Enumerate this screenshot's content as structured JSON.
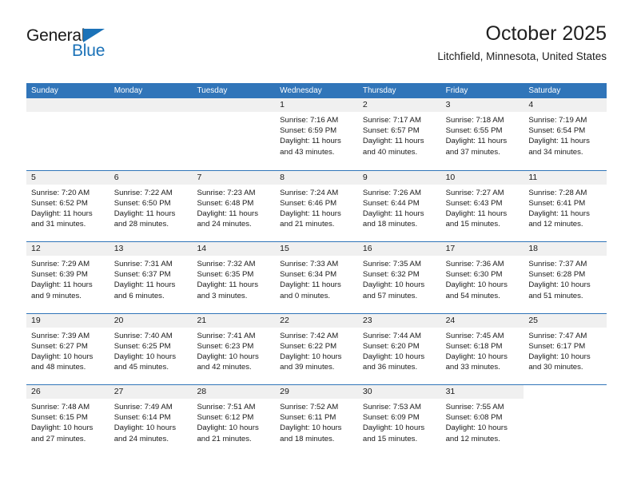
{
  "brand": {
    "word_general": "General",
    "word_blue": "Blue",
    "triangle_color": "#1b72b8"
  },
  "header": {
    "title": "October 2025",
    "subtitle": "Litchfield, Minnesota, United States"
  },
  "theme": {
    "header_blue": "#3175b9",
    "daynum_strip": "#f0f0f0",
    "text": "#1a1a1a",
    "page_background": "#ffffff"
  },
  "weekdays": [
    "Sunday",
    "Monday",
    "Tuesday",
    "Wednesday",
    "Thursday",
    "Friday",
    "Saturday"
  ],
  "labels": {
    "sunrise_prefix": "Sunrise:",
    "sunset_prefix": "Sunset:",
    "daylight_prefix": "Daylight:"
  },
  "weeks": [
    [
      {
        "day": "",
        "empty": true
      },
      {
        "day": "",
        "empty": true
      },
      {
        "day": "",
        "empty": true
      },
      {
        "day": "1",
        "sunrise": "Sunrise: 7:16 AM",
        "sunset": "Sunset: 6:59 PM",
        "daylight": "Daylight: 11 hours and 43 minutes."
      },
      {
        "day": "2",
        "sunrise": "Sunrise: 7:17 AM",
        "sunset": "Sunset: 6:57 PM",
        "daylight": "Daylight: 11 hours and 40 minutes."
      },
      {
        "day": "3",
        "sunrise": "Sunrise: 7:18 AM",
        "sunset": "Sunset: 6:55 PM",
        "daylight": "Daylight: 11 hours and 37 minutes."
      },
      {
        "day": "4",
        "sunrise": "Sunrise: 7:19 AM",
        "sunset": "Sunset: 6:54 PM",
        "daylight": "Daylight: 11 hours and 34 minutes."
      }
    ],
    [
      {
        "day": "5",
        "sunrise": "Sunrise: 7:20 AM",
        "sunset": "Sunset: 6:52 PM",
        "daylight": "Daylight: 11 hours and 31 minutes."
      },
      {
        "day": "6",
        "sunrise": "Sunrise: 7:22 AM",
        "sunset": "Sunset: 6:50 PM",
        "daylight": "Daylight: 11 hours and 28 minutes."
      },
      {
        "day": "7",
        "sunrise": "Sunrise: 7:23 AM",
        "sunset": "Sunset: 6:48 PM",
        "daylight": "Daylight: 11 hours and 24 minutes."
      },
      {
        "day": "8",
        "sunrise": "Sunrise: 7:24 AM",
        "sunset": "Sunset: 6:46 PM",
        "daylight": "Daylight: 11 hours and 21 minutes."
      },
      {
        "day": "9",
        "sunrise": "Sunrise: 7:26 AM",
        "sunset": "Sunset: 6:44 PM",
        "daylight": "Daylight: 11 hours and 18 minutes."
      },
      {
        "day": "10",
        "sunrise": "Sunrise: 7:27 AM",
        "sunset": "Sunset: 6:43 PM",
        "daylight": "Daylight: 11 hours and 15 minutes."
      },
      {
        "day": "11",
        "sunrise": "Sunrise: 7:28 AM",
        "sunset": "Sunset: 6:41 PM",
        "daylight": "Daylight: 11 hours and 12 minutes."
      }
    ],
    [
      {
        "day": "12",
        "sunrise": "Sunrise: 7:29 AM",
        "sunset": "Sunset: 6:39 PM",
        "daylight": "Daylight: 11 hours and 9 minutes."
      },
      {
        "day": "13",
        "sunrise": "Sunrise: 7:31 AM",
        "sunset": "Sunset: 6:37 PM",
        "daylight": "Daylight: 11 hours and 6 minutes."
      },
      {
        "day": "14",
        "sunrise": "Sunrise: 7:32 AM",
        "sunset": "Sunset: 6:35 PM",
        "daylight": "Daylight: 11 hours and 3 minutes."
      },
      {
        "day": "15",
        "sunrise": "Sunrise: 7:33 AM",
        "sunset": "Sunset: 6:34 PM",
        "daylight": "Daylight: 11 hours and 0 minutes."
      },
      {
        "day": "16",
        "sunrise": "Sunrise: 7:35 AM",
        "sunset": "Sunset: 6:32 PM",
        "daylight": "Daylight: 10 hours and 57 minutes."
      },
      {
        "day": "17",
        "sunrise": "Sunrise: 7:36 AM",
        "sunset": "Sunset: 6:30 PM",
        "daylight": "Daylight: 10 hours and 54 minutes."
      },
      {
        "day": "18",
        "sunrise": "Sunrise: 7:37 AM",
        "sunset": "Sunset: 6:28 PM",
        "daylight": "Daylight: 10 hours and 51 minutes."
      }
    ],
    [
      {
        "day": "19",
        "sunrise": "Sunrise: 7:39 AM",
        "sunset": "Sunset: 6:27 PM",
        "daylight": "Daylight: 10 hours and 48 minutes."
      },
      {
        "day": "20",
        "sunrise": "Sunrise: 7:40 AM",
        "sunset": "Sunset: 6:25 PM",
        "daylight": "Daylight: 10 hours and 45 minutes."
      },
      {
        "day": "21",
        "sunrise": "Sunrise: 7:41 AM",
        "sunset": "Sunset: 6:23 PM",
        "daylight": "Daylight: 10 hours and 42 minutes."
      },
      {
        "day": "22",
        "sunrise": "Sunrise: 7:42 AM",
        "sunset": "Sunset: 6:22 PM",
        "daylight": "Daylight: 10 hours and 39 minutes."
      },
      {
        "day": "23",
        "sunrise": "Sunrise: 7:44 AM",
        "sunset": "Sunset: 6:20 PM",
        "daylight": "Daylight: 10 hours and 36 minutes."
      },
      {
        "day": "24",
        "sunrise": "Sunrise: 7:45 AM",
        "sunset": "Sunset: 6:18 PM",
        "daylight": "Daylight: 10 hours and 33 minutes."
      },
      {
        "day": "25",
        "sunrise": "Sunrise: 7:47 AM",
        "sunset": "Sunset: 6:17 PM",
        "daylight": "Daylight: 10 hours and 30 minutes."
      }
    ],
    [
      {
        "day": "26",
        "sunrise": "Sunrise: 7:48 AM",
        "sunset": "Sunset: 6:15 PM",
        "daylight": "Daylight: 10 hours and 27 minutes."
      },
      {
        "day": "27",
        "sunrise": "Sunrise: 7:49 AM",
        "sunset": "Sunset: 6:14 PM",
        "daylight": "Daylight: 10 hours and 24 minutes."
      },
      {
        "day": "28",
        "sunrise": "Sunrise: 7:51 AM",
        "sunset": "Sunset: 6:12 PM",
        "daylight": "Daylight: 10 hours and 21 minutes."
      },
      {
        "day": "29",
        "sunrise": "Sunrise: 7:52 AM",
        "sunset": "Sunset: 6:11 PM",
        "daylight": "Daylight: 10 hours and 18 minutes."
      },
      {
        "day": "30",
        "sunrise": "Sunrise: 7:53 AM",
        "sunset": "Sunset: 6:09 PM",
        "daylight": "Daylight: 10 hours and 15 minutes."
      },
      {
        "day": "31",
        "sunrise": "Sunrise: 7:55 AM",
        "sunset": "Sunset: 6:08 PM",
        "daylight": "Daylight: 10 hours and 12 minutes."
      },
      {
        "day": "",
        "empty": true,
        "blank": true
      }
    ]
  ]
}
